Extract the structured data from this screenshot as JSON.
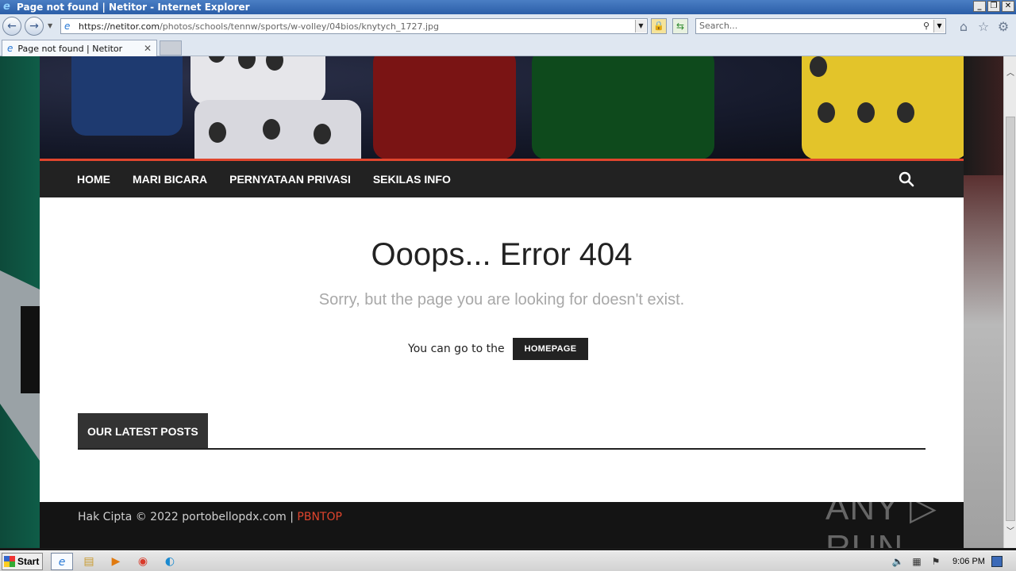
{
  "browser": {
    "window_title": "Page not found | Netitor - Internet Explorer",
    "url_host": "https://netitor.com",
    "url_path": "/photos/schools/tennw/sports/w-volley/04bios/knytych_1727.jpg",
    "search_placeholder": "Search...",
    "tab_title": "Page not found | Netitor"
  },
  "site": {
    "nav": [
      {
        "label": "HOME"
      },
      {
        "label": "MARI BICARA"
      },
      {
        "label": "PERNYATAAN PRIVASI"
      },
      {
        "label": "SEKILAS INFO"
      }
    ],
    "error_title": "Ooops... Error 404",
    "error_subtitle": "Sorry, but the page you are looking for doesn't exist.",
    "goto_text": "You can go to the",
    "homepage_button": "HOMEPAGE",
    "latest_posts_title": "OUR LATEST POSTS",
    "footer_text": "Hak Cipta © 2022 portobellopdx.com | ",
    "footer_link": "PBNTOP",
    "watermark": "ANY ▷ RUN",
    "accent_color": "#e0452d"
  },
  "taskbar": {
    "start_label": "Start",
    "clock": "9:06 PM"
  }
}
